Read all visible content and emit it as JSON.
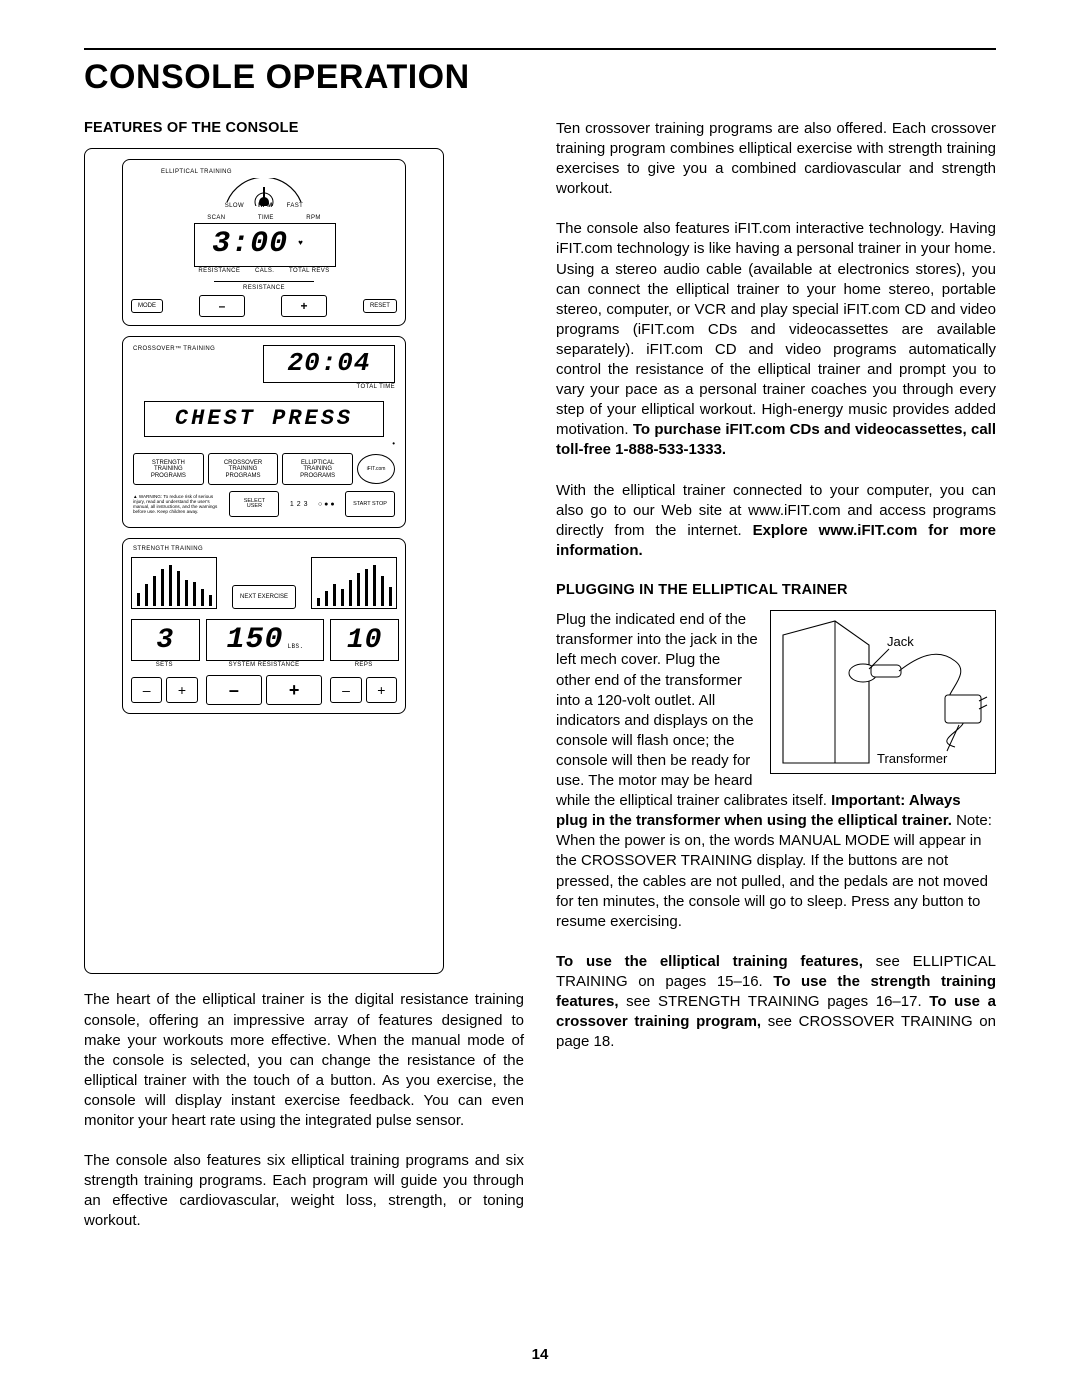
{
  "title": "CONSOLE OPERATION",
  "page_number": "14",
  "left": {
    "subhead": "FEATURES OF THE CONSOLE",
    "para1": "The heart of the elliptical trainer is the digital resistance training console, offering an impressive array of features designed to make your workouts more effective. When the manual mode of the console is selected, you can change the resistance of the elliptical trainer with the touch of a button. As you exercise, the console will display instant exercise feedback. You can even monitor your heart rate using the integrated pulse sensor.",
    "para2": "The console also features six elliptical training programs and six strength training programs. Each program will guide you through an effective cardiovascular, weight loss, strength, or toning workout."
  },
  "right": {
    "para1": "Ten crossover training programs are also offered. Each crossover training program combines elliptical exercise with strength training exercises to give you a combined cardiovascular and strength workout.",
    "para2_a": "The console also features iFIT.com interactive technology. Having iFIT.com technology is like having a personal trainer in your home. Using a stereo audio cable (available at electronics stores), you can connect the elliptical trainer to your home stereo, portable stereo, computer, or VCR and play special iFIT.com CD and video programs (iFIT.com CDs and videocassettes are available separately). iFIT.com CD and video programs automatically control the resistance of the elliptical trainer and prompt you to vary your pace as a personal trainer coaches you through every step of your elliptical workout. High-energy music provides added motivation. ",
    "para2_b": "To purchase iFIT.com CDs and videocassettes, call toll-free 1-888-533-1333.",
    "para3_a": "With the elliptical trainer connected to your computer, you can also go to our Web site at www.iFIT.com and access programs directly from the internet. ",
    "para3_b": "Explore www.iFIT.com for more information.",
    "subhead2": "PLUGGING IN THE ELLIPTICAL TRAINER",
    "para4_a": "Plug the indicated end of the transformer into the jack in the left mech cover. Plug the other end of the transformer into a 120-volt outlet. All indicators and displays on the con",
    "para4_b": "sole will flash once; the console will then be ready for use. The motor may be heard while the elliptical trainer calibrates itself. ",
    "para4_c": "Important: Always plug in the transformer when using the elliptical trainer.",
    "para4_d": " Note: When the power is on, the words MANUAL MODE will appear in the CROSSOVER TRAINING display. If the buttons are not pressed, the cables are not pulled, and the pedals are not moved for ten minutes, the console will go to sleep. Press any button to resume exercising.",
    "para5_a": "To use the elliptical training features,",
    "para5_b": " see ELLIPTICAL TRAINING on pages 15–16. ",
    "para5_c": "To use the strength training features,",
    "para5_d": " see STRENGTH TRAINING pages 16–17. ",
    "para5_e": "To use a crossover training program,",
    "para5_f": " see CROSSOVER TRAINING on page 18."
  },
  "jack": {
    "label_jack": "Jack",
    "label_transformer": "Transformer"
  },
  "console": {
    "elliptical_label": "ELLIPTICAL TRAINING",
    "rpm_slow": "SLOW",
    "rpm": "RPM",
    "rpm_fast": "FAST",
    "row1": {
      "scan": "SCAN",
      "time": "TIME",
      "rpm": "RPM"
    },
    "display_main": "3:00",
    "row2": {
      "res": "RESISTANCE",
      "cals": "CALS.",
      "revs": "TOTAL REVS"
    },
    "resistance_label": "RESISTANCE",
    "mode": "MODE",
    "reset": "RESET",
    "crossover_label": "CROSSOVER™ TRAINING",
    "display_cross": "20:04",
    "total_time": "TOTAL TIME",
    "chest_press": "CHEST PRESS",
    "p1": "STRENGTH TRAINING PROGRAMS",
    "p2": "CROSSOVER TRAINING PROGRAMS",
    "p3": "ELLIPTICAL TRAINING PROGRAMS",
    "ifit": "iFIT.com",
    "select_user": "SELECT USER",
    "start_stop": "START STOP",
    "num1": "1",
    "num2": "2",
    "num3": "3",
    "warning": "WARNING: To reduce risk of serious injury, read and understand the user's manual, all instructions, and the warnings before use. Keep children away.",
    "strength_label": "STRENGTH TRAINING",
    "next_exercise": "NEXT EXERCISE",
    "sets_val": "3",
    "sysres_val": "150",
    "lbs": "LBS.",
    "reps_val": "10",
    "sets": "SETS",
    "sysres": "SYSTEM RESISTANCE",
    "reps": "REPS",
    "minus": "–",
    "plus": "+"
  }
}
